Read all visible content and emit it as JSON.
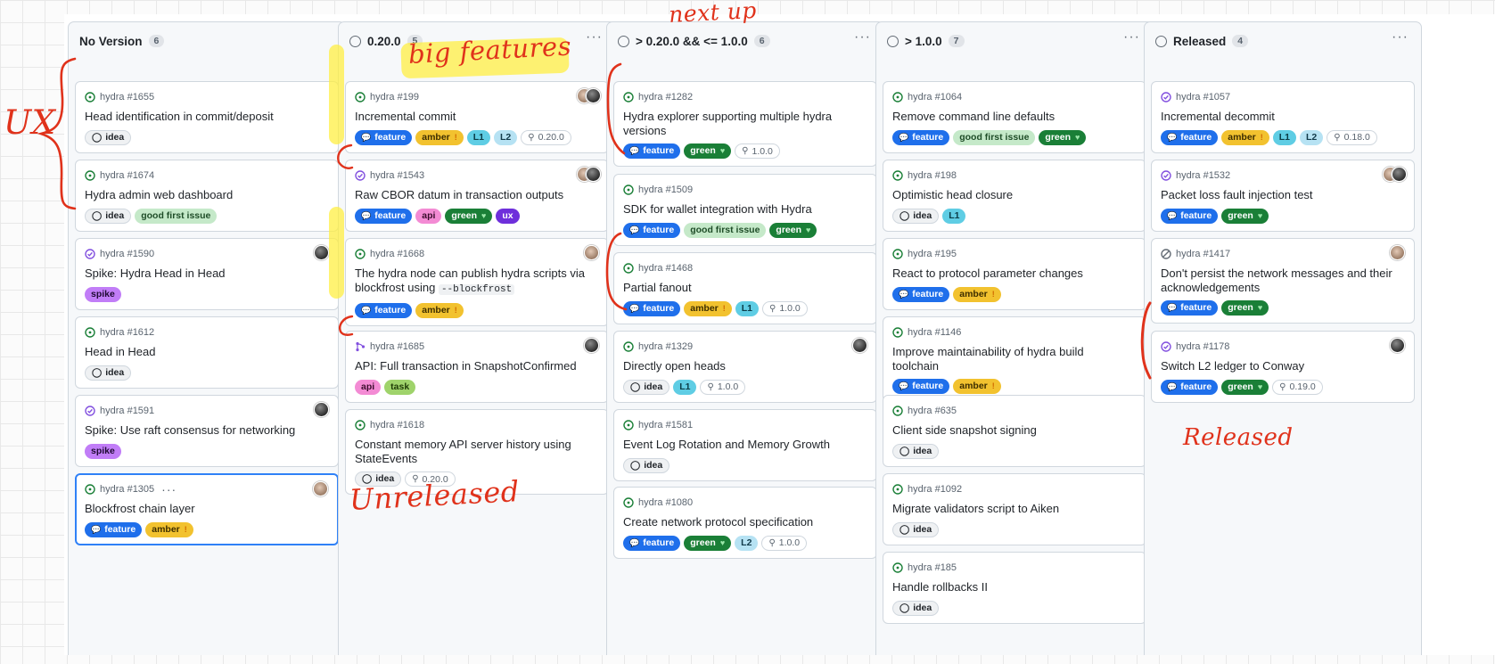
{
  "colors": {
    "feature": "#1f6feb",
    "amber": "#f2c22f",
    "green": "#1a7f37",
    "good_first_issue": "#c5e9c9",
    "spike": "#c17df7",
    "api": "#f38bd4",
    "ux": "#6e2fdb",
    "task": "#9fd36b",
    "l1": "#5fcde4",
    "l2": "#b6e2f3",
    "idea": "#eff1f3",
    "annotation": "#e0321b"
  },
  "columns": [
    {
      "title": "No Version",
      "count": "6",
      "cards": [
        {
          "ref": "hydra #1655",
          "title": "Head identification in commit/deposit",
          "state": "open",
          "labels": [
            {
              "text": "idea",
              "kind": "idea"
            }
          ]
        },
        {
          "ref": "hydra #1674",
          "title": "Hydra admin web dashboard",
          "state": "open",
          "labels": [
            {
              "text": "idea",
              "kind": "idea"
            },
            {
              "text": "good first issue",
              "kind": "gfi"
            }
          ]
        },
        {
          "ref": "hydra #1590",
          "title": "Spike: Hydra Head in Head",
          "state": "closed",
          "labels": [
            {
              "text": "spike",
              "kind": "spike"
            }
          ]
        },
        {
          "ref": "hydra #1612",
          "title": "Head in Head",
          "state": "open",
          "labels": [
            {
              "text": "idea",
              "kind": "idea"
            }
          ]
        },
        {
          "ref": "hydra #1591",
          "title": "Spike: Use raft consensus for networking",
          "state": "closed",
          "labels": [
            {
              "text": "spike",
              "kind": "spike"
            }
          ]
        },
        {
          "ref": "hydra #1305",
          "title": "Blockfrost chain layer",
          "state": "open",
          "labels": [
            {
              "text": "feature",
              "kind": "feature"
            },
            {
              "text": "amber",
              "kind": "amber"
            }
          ]
        }
      ]
    },
    {
      "title": "0.20.0",
      "count": "5",
      "cards": [
        {
          "ref": "hydra #199",
          "title": "Incremental commit",
          "state": "open",
          "labels": [
            {
              "text": "feature",
              "kind": "feature"
            },
            {
              "text": "amber",
              "kind": "amber"
            },
            {
              "text": "L1",
              "kind": "l1"
            },
            {
              "text": "L2",
              "kind": "l2"
            }
          ],
          "milestone": "0.20.0"
        },
        {
          "ref": "hydra #1543",
          "title": "Raw CBOR datum in transaction outputs",
          "state": "closed",
          "labels": [
            {
              "text": "feature",
              "kind": "feature"
            },
            {
              "text": "api",
              "kind": "api"
            },
            {
              "text": "green",
              "kind": "green"
            },
            {
              "text": "ux",
              "kind": "ux"
            }
          ]
        },
        {
          "ref": "hydra #1668",
          "title": "The hydra node can publish hydra scripts via blockfrost using",
          "code": "--blockfrost",
          "state": "open",
          "labels": [
            {
              "text": "feature",
              "kind": "feature"
            },
            {
              "text": "amber",
              "kind": "amber"
            }
          ]
        },
        {
          "ref": "hydra #1685",
          "title": "API: Full transaction in SnapshotConfirmed",
          "state": "pr",
          "labels": [
            {
              "text": "api",
              "kind": "api"
            },
            {
              "text": "task",
              "kind": "task"
            }
          ]
        },
        {
          "ref": "hydra #1618",
          "title": "Constant memory API server history using StateEvents",
          "state": "open",
          "labels": [
            {
              "text": "idea",
              "kind": "idea"
            }
          ],
          "milestone": "0.20.0"
        }
      ]
    },
    {
      "title": "> 0.20.0 && <= 1.0.0",
      "count": "6",
      "cards": [
        {
          "ref": "hydra #1282",
          "title": "Hydra explorer supporting multiple hydra versions",
          "state": "open",
          "labels": [
            {
              "text": "feature",
              "kind": "feature"
            },
            {
              "text": "green",
              "kind": "green"
            }
          ],
          "milestone": "1.0.0"
        },
        {
          "ref": "hydra #1509",
          "title": "SDK for wallet integration with Hydra",
          "state": "open",
          "labels": [
            {
              "text": "feature",
              "kind": "feature"
            },
            {
              "text": "good first issue",
              "kind": "gfi"
            },
            {
              "text": "green",
              "kind": "green"
            }
          ]
        },
        {
          "ref": "hydra #1468",
          "title": "Partial fanout",
          "state": "open",
          "labels": [
            {
              "text": "feature",
              "kind": "feature"
            },
            {
              "text": "amber",
              "kind": "amber"
            },
            {
              "text": "L1",
              "kind": "l1"
            }
          ],
          "milestone": "1.0.0"
        },
        {
          "ref": "hydra #1329",
          "title": "Directly open heads",
          "state": "open",
          "labels": [
            {
              "text": "idea",
              "kind": "idea"
            },
            {
              "text": "L1",
              "kind": "l1"
            }
          ],
          "milestone": "1.0.0"
        },
        {
          "ref": "hydra #1581",
          "title": "Event Log Rotation and Memory Growth",
          "state": "open",
          "labels": [
            {
              "text": "idea",
              "kind": "idea"
            }
          ]
        },
        {
          "ref": "hydra #1080",
          "title": "Create network protocol specification",
          "state": "open",
          "labels": [
            {
              "text": "feature",
              "kind": "feature"
            },
            {
              "text": "green",
              "kind": "green"
            },
            {
              "text": "L2",
              "kind": "l2"
            }
          ],
          "milestone": "1.0.0"
        }
      ]
    },
    {
      "title": "> 1.0.0",
      "count": "7",
      "cards": [
        {
          "ref": "hydra #1064",
          "title": "Remove command line defaults",
          "state": "open",
          "labels": [
            {
              "text": "feature",
              "kind": "feature"
            },
            {
              "text": "good first issue",
              "kind": "gfi"
            },
            {
              "text": "green",
              "kind": "green"
            }
          ]
        },
        {
          "ref": "hydra #198",
          "title": "Optimistic head closure",
          "state": "open",
          "labels": [
            {
              "text": "idea",
              "kind": "idea"
            },
            {
              "text": "L1",
              "kind": "l1"
            }
          ]
        },
        {
          "ref": "hydra #195",
          "title": "React to protocol parameter changes",
          "state": "open",
          "labels": [
            {
              "text": "feature",
              "kind": "feature"
            },
            {
              "text": "amber",
              "kind": "amber"
            }
          ]
        },
        {
          "ref": "hydra #1146",
          "title": "Improve maintainability of hydra build toolchain",
          "state": "open",
          "labels": [
            {
              "text": "feature",
              "kind": "feature"
            },
            {
              "text": "amber",
              "kind": "amber"
            }
          ]
        },
        {
          "ref": "hydra #635",
          "title": "Client side snapshot signing",
          "state": "open",
          "labels": [
            {
              "text": "idea",
              "kind": "idea"
            }
          ]
        },
        {
          "ref": "hydra #1092",
          "title": "Migrate validators script to Aiken",
          "state": "open",
          "labels": [
            {
              "text": "idea",
              "kind": "idea"
            }
          ]
        },
        {
          "ref": "hydra #185",
          "title": "Handle rollbacks II",
          "state": "open",
          "labels": [
            {
              "text": "idea",
              "kind": "idea"
            }
          ]
        }
      ]
    },
    {
      "title": "Released",
      "count": "4",
      "cards": [
        {
          "ref": "hydra #1057",
          "title": "Incremental decommit",
          "state": "closed",
          "labels": [
            {
              "text": "feature",
              "kind": "feature"
            },
            {
              "text": "amber",
              "kind": "amber"
            },
            {
              "text": "L1",
              "kind": "l1"
            },
            {
              "text": "L2",
              "kind": "l2"
            }
          ],
          "milestone": "0.18.0"
        },
        {
          "ref": "hydra #1532",
          "title": "Packet loss fault injection test",
          "state": "closed",
          "labels": [
            {
              "text": "feature",
              "kind": "feature"
            },
            {
              "text": "green",
              "kind": "green"
            }
          ]
        },
        {
          "ref": "hydra #1417",
          "title": "Don't persist the network messages and their acknowledgements",
          "state": "notplanned",
          "labels": [
            {
              "text": "feature",
              "kind": "feature"
            },
            {
              "text": "green",
              "kind": "green"
            }
          ]
        },
        {
          "ref": "hydra #1178",
          "title": "Switch L2 ledger to Conway",
          "state": "closed",
          "labels": [
            {
              "text": "feature",
              "kind": "feature"
            },
            {
              "text": "green",
              "kind": "green"
            }
          ],
          "milestone": "0.19.0"
        }
      ]
    }
  ],
  "annotations": {
    "ux": "UX",
    "big_features": "big features",
    "next_up": "next up",
    "unreleased": "Unreleased",
    "released": "Released"
  },
  "icons": {
    "feature": "speech-bubble-icon",
    "amber": "warning-icon",
    "green": "heart-icon",
    "milestone": "milestone-signpost-icon",
    "idea": "comment-icon",
    "open": "issue-open-icon",
    "closed": "issue-closed-icon",
    "pr": "pull-request-icon",
    "notplanned": "not-planned-icon",
    "menu": "kebab-menu-icon",
    "col": "status-ring-icon"
  }
}
